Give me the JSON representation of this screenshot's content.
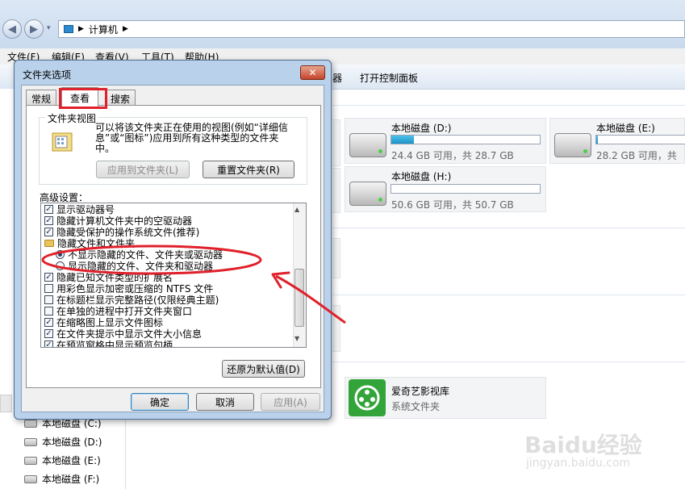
{
  "explorer": {
    "breadcrumb": [
      "计算机"
    ],
    "menu": [
      "文件(F)",
      "编辑(E)",
      "查看(V)",
      "工具(T)",
      "帮助(H)"
    ],
    "toolbar_partial": "器",
    "toolbar_control_panel": "打开控制面板",
    "drives": [
      {
        "name": "本地磁盘 (D:)",
        "space": "24.4 GB 可用，共 28.7 GB",
        "used_fraction": 0.15
      },
      {
        "name": "本地磁盘 (E:)",
        "space": "28.2 GB 可用，共",
        "used_fraction": 0.02
      },
      {
        "name": "本地磁盘 (H:)",
        "space": "50.6 GB 可用，共 50.7 GB",
        "used_fraction": 0.0
      }
    ],
    "library": {
      "name": "爱奇艺影视库",
      "type": "系统文件夹"
    },
    "nav_drives": [
      "本地磁盘 (C:)",
      "本地磁盘 (D:)",
      "本地磁盘 (E:)",
      "本地磁盘 (F:)"
    ]
  },
  "dialog": {
    "title": "文件夹选项",
    "tabs": [
      "常规",
      "查看",
      "搜索"
    ],
    "active_tab": "查看",
    "group_title": "文件夹视图",
    "group_desc": "可以将该文件夹正在使用的视图(例如“详细信息”或“图标”)应用到所有这种类型的文件夹中。",
    "apply_to_folders": "应用到文件夹(L)",
    "reset_folders": "重置文件夹(R)",
    "advanced_label": "高级设置：",
    "settings": [
      {
        "kind": "check",
        "checked": true,
        "label": "显示驱动器号"
      },
      {
        "kind": "check",
        "checked": true,
        "label": "隐藏计算机文件夹中的空驱动器"
      },
      {
        "kind": "check",
        "checked": true,
        "label": "隐藏受保护的操作系统文件(推荐)"
      },
      {
        "kind": "folder",
        "label": "隐藏文件和文件夹"
      },
      {
        "kind": "radio",
        "checked": true,
        "label": "不显示隐藏的文件、文件夹或驱动器"
      },
      {
        "kind": "radio",
        "checked": false,
        "label": "显示隐藏的文件、文件夹和驱动器"
      },
      {
        "kind": "check",
        "checked": true,
        "label": "隐藏已知文件类型的扩展名"
      },
      {
        "kind": "check",
        "checked": false,
        "label": "用彩色显示加密或压缩的 NTFS 文件"
      },
      {
        "kind": "check",
        "checked": false,
        "label": "在标题栏显示完整路径(仅限经典主题)"
      },
      {
        "kind": "check",
        "checked": false,
        "label": "在单独的进程中打开文件夹窗口"
      },
      {
        "kind": "check",
        "checked": true,
        "label": "在缩略图上显示文件图标"
      },
      {
        "kind": "check",
        "checked": true,
        "label": "在文件夹提示中显示文件大小信息"
      },
      {
        "kind": "check",
        "checked": true,
        "label": "在预览窗格中显示预览句柄"
      }
    ],
    "restore_defaults": "还原为默认值(D)",
    "ok": "确定",
    "cancel": "取消",
    "apply": "应用(A)"
  },
  "annotation_colors": {
    "highlight": "#e0202a"
  },
  "watermark": {
    "brand": "Baidu经验",
    "url": "jingyan.baidu.com"
  }
}
